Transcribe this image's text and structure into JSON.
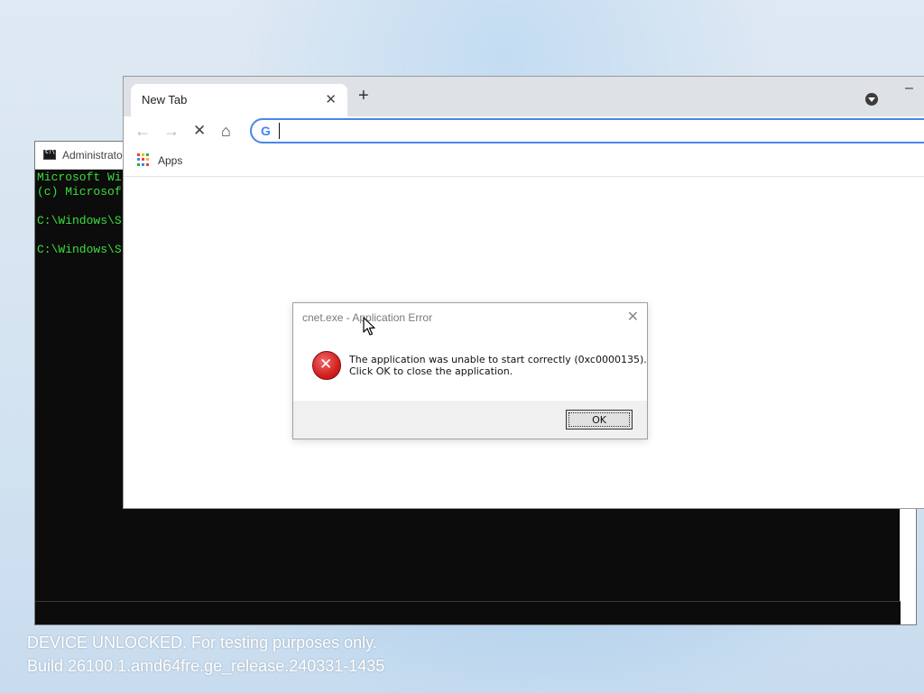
{
  "cmd": {
    "title": "Administrato",
    "lines": "Microsoft Wi\n(c) Microsof\n\nC:\\Windows\\S\n\nC:\\Windows\\S"
  },
  "browser": {
    "tab_title": "New Tab",
    "tab_close": "✕",
    "new_tab": "+",
    "minimize": "–",
    "nav": {
      "back": "←",
      "forward": "→",
      "stop": "✕",
      "home": "⌂"
    },
    "search_engine_icon": "G",
    "address_value": "",
    "bookmarks": {
      "apps_label": "Apps",
      "apps_colors": [
        "#ea4335",
        "#fbbc05",
        "#34a853",
        "#4285f4",
        "#ea4335",
        "#fbbc05",
        "#34a853",
        "#4285f4",
        "#ea4335"
      ]
    }
  },
  "dialog": {
    "title": "cnet.exe - Application Error",
    "close": "✕",
    "message_line1": "The application was unable to start correctly (0xc0000135).",
    "message_line2": "Click OK to close the application.",
    "ok_label": "OK"
  },
  "watermark": {
    "line1": "DEVICE UNLOCKED. For testing purposes only.",
    "line2": "Build 26100.1.amd64fre.ge_release.240331-1435"
  }
}
